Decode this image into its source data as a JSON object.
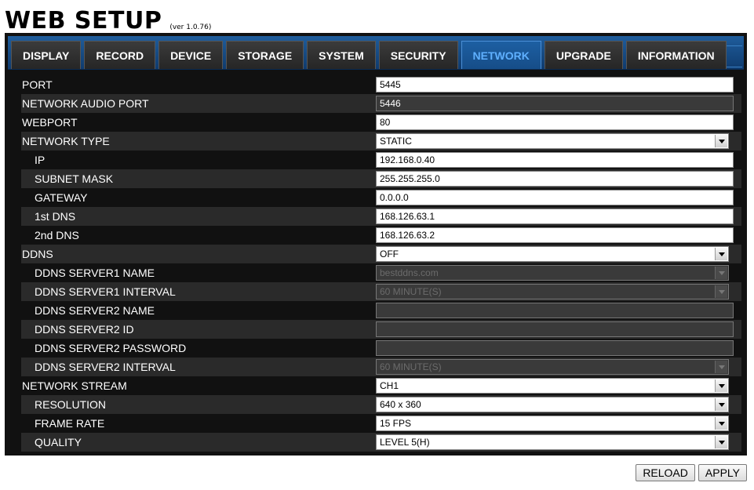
{
  "header": {
    "title": "WEB SETUP",
    "version": "(ver 1.0.76)"
  },
  "tabs": [
    "DISPLAY",
    "RECORD",
    "DEVICE",
    "STORAGE",
    "SYSTEM",
    "SECURITY",
    "NETWORK",
    "UPGRADE",
    "INFORMATION"
  ],
  "active_tab": "NETWORK",
  "form": {
    "port": {
      "label": "PORT",
      "value": "5445"
    },
    "network_audio_port": {
      "label": "NETWORK AUDIO PORT",
      "value": "5446"
    },
    "webport": {
      "label": "WEBPORT",
      "value": "80"
    },
    "network_type": {
      "label": "NETWORK TYPE",
      "value": "STATIC"
    },
    "ip": {
      "label": "IP",
      "value": "192.168.0.40"
    },
    "subnet_mask": {
      "label": "SUBNET MASK",
      "value": "255.255.255.0"
    },
    "gateway": {
      "label": "GATEWAY",
      "value": "0.0.0.0"
    },
    "dns1": {
      "label": "1st DNS",
      "value": "168.126.63.1"
    },
    "dns2": {
      "label": "2nd DNS",
      "value": "168.126.63.2"
    },
    "ddns": {
      "label": "DDNS",
      "value": "OFF"
    },
    "ddns_server1_name": {
      "label": "DDNS SERVER1 NAME",
      "value": "bestddns.com"
    },
    "ddns_server1_interval": {
      "label": "DDNS SERVER1 INTERVAL",
      "value": "60 MINUTE(S)"
    },
    "ddns_server2_name": {
      "label": "DDNS SERVER2 NAME",
      "value": ""
    },
    "ddns_server2_id": {
      "label": "DDNS SERVER2 ID",
      "value": ""
    },
    "ddns_server2_password": {
      "label": "DDNS SERVER2 PASSWORD",
      "value": ""
    },
    "ddns_server2_interval": {
      "label": "DDNS SERVER2 INTERVAL",
      "value": "60 MINUTE(S)"
    },
    "network_stream": {
      "label": "NETWORK STREAM",
      "value": "CH1"
    },
    "resolution": {
      "label": "RESOLUTION",
      "value": "640 x 360"
    },
    "frame_rate": {
      "label": "FRAME RATE",
      "value": "15 FPS"
    },
    "quality": {
      "label": "QUALITY",
      "value": "LEVEL 5(H)"
    }
  },
  "buttons": {
    "reload": "RELOAD",
    "apply": "APPLY"
  }
}
